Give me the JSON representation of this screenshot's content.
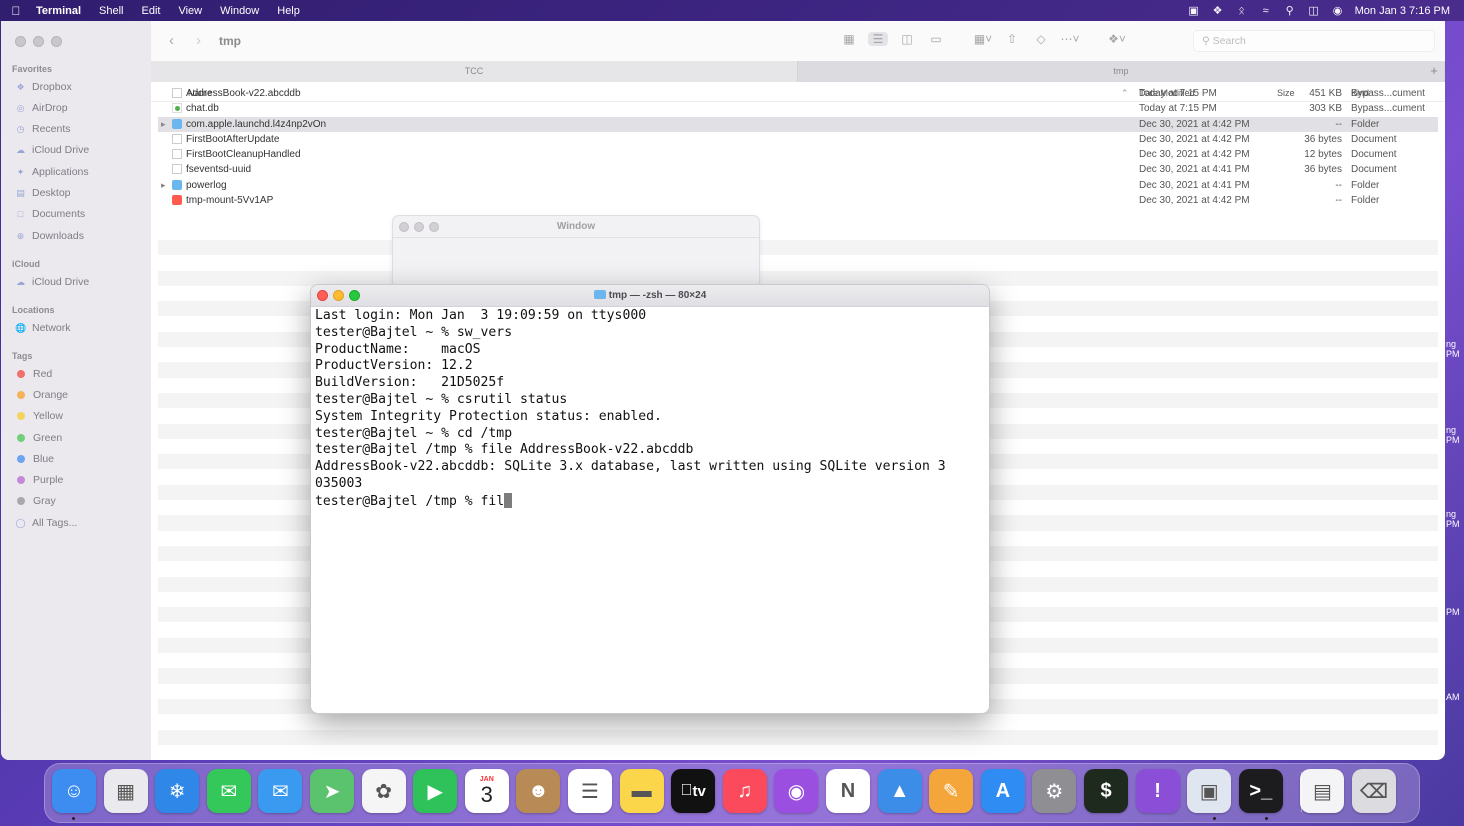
{
  "menubar": {
    "app": "Terminal",
    "items": [
      "Shell",
      "Edit",
      "View",
      "Window",
      "Help"
    ],
    "clock": "Mon Jan 3  7:16 PM",
    "status_icons": [
      "screen-mirror-icon",
      "dropbox-icon",
      "bluetooth-icon",
      "wifi-icon",
      "search-icon",
      "control-center-icon",
      "siri-icon"
    ]
  },
  "finder": {
    "title": "tmp",
    "search_placeholder": "Search",
    "tabs": [
      "TCC",
      "tmp"
    ],
    "sidebar": {
      "favorites_label": "Favorites",
      "favorites": [
        "Dropbox",
        "AirDrop",
        "Recents",
        "iCloud Drive",
        "Applications",
        "Desktop",
        "Documents",
        "Downloads"
      ],
      "icloud_label": "iCloud",
      "icloud": [
        "iCloud Drive"
      ],
      "locations_label": "Locations",
      "locations": [
        "Network"
      ],
      "tags_label": "Tags",
      "tags": [
        {
          "name": "Red",
          "color": "#f0706a"
        },
        {
          "name": "Orange",
          "color": "#f5b25a"
        },
        {
          "name": "Yellow",
          "color": "#f3d45c"
        },
        {
          "name": "Green",
          "color": "#6fcf7a"
        },
        {
          "name": "Blue",
          "color": "#6aa4f2"
        },
        {
          "name": "Purple",
          "color": "#c38ad9"
        },
        {
          "name": "Gray",
          "color": "#a8a8ad"
        }
      ],
      "all_tags": "All Tags..."
    },
    "columns": {
      "name": "Name",
      "date": "Date Modified",
      "size": "Size",
      "kind": "Kind"
    },
    "files": [
      {
        "name": "AddressBook-v22.abcddb",
        "date": "Today at 7:15 PM",
        "size": "451 KB",
        "kind": "Bypass...cument",
        "icon": "doc",
        "folder": false
      },
      {
        "name": "chat.db",
        "date": "Today at 7:15 PM",
        "size": "303 KB",
        "kind": "Bypass...cument",
        "icon": "db",
        "folder": false
      },
      {
        "name": "com.apple.launchd.l4z4np2vOn",
        "date": "Dec 30, 2021 at 4:42 PM",
        "size": "--",
        "kind": "Folder",
        "icon": "folder",
        "folder": true,
        "selected": true
      },
      {
        "name": "FirstBootAfterUpdate",
        "date": "Dec 30, 2021 at 4:42 PM",
        "size": "36 bytes",
        "kind": "Document",
        "icon": "doc",
        "folder": false
      },
      {
        "name": "FirstBootCleanupHandled",
        "date": "Dec 30, 2021 at 4:42 PM",
        "size": "12 bytes",
        "kind": "Document",
        "icon": "doc",
        "folder": false
      },
      {
        "name": "fseventsd-uuid",
        "date": "Dec 30, 2021 at 4:41 PM",
        "size": "36 bytes",
        "kind": "Document",
        "icon": "doc",
        "folder": false
      },
      {
        "name": "powerlog",
        "date": "Dec 30, 2021 at 4:41 PM",
        "size": "--",
        "kind": "Folder",
        "icon": "folder",
        "folder": true
      },
      {
        "name": "tmp-mount-5Vv1AP",
        "date": "Dec 30, 2021 at 4:42 PM",
        "size": "--",
        "kind": "Folder",
        "icon": "disk",
        "folder": false
      }
    ]
  },
  "bg_window": {
    "title": "Window"
  },
  "terminal": {
    "title": "tmp — -zsh — 80×24",
    "lines": [
      "Last login: Mon Jan  3 19:09:59 on ttys000",
      "tester@Bajtel ~ % sw_vers",
      "ProductName:    macOS",
      "ProductVersion: 12.2",
      "BuildVersion:   21D5025f",
      "tester@Bajtel ~ % csrutil status",
      "System Integrity Protection status: enabled.",
      "tester@Bajtel ~ % cd /tmp",
      "tester@Bajtel /tmp % file AddressBook-v22.abcddb",
      "AddressBook-v22.abcddb: SQLite 3.x database, last written using SQLite version 3",
      "035003"
    ],
    "prompt_line": "tester@Bajtel /tmp % fil"
  },
  "edge_text": [
    {
      "text": "ng\nPM"
    },
    {
      "text": "ng\nPM"
    },
    {
      "text": "ng\nPM"
    },
    {
      "text": "PM"
    },
    {
      "text": "AM"
    }
  ],
  "dock": {
    "calendar_month": "JAN",
    "calendar_day": "3",
    "tv_label": "tv",
    "apps": [
      {
        "name": "finder-icon",
        "color": "#3d8df0"
      },
      {
        "name": "launchpad-icon",
        "color": "#e9e9ee"
      },
      {
        "name": "safari-icon",
        "color": "#2f88e8"
      },
      {
        "name": "messages-icon",
        "color": "#34c759"
      },
      {
        "name": "mail-icon",
        "color": "#3a9af0"
      },
      {
        "name": "maps-icon",
        "color": "#5bc26e"
      },
      {
        "name": "photos-icon",
        "color": "#f5f5f5"
      },
      {
        "name": "facetime-icon",
        "color": "#2fc25a"
      },
      {
        "name": "calendar-icon",
        "color": "#ffffff"
      },
      {
        "name": "contacts-icon",
        "color": "#b88a55"
      },
      {
        "name": "reminders-icon",
        "color": "#ffffff"
      },
      {
        "name": "notes-icon",
        "color": "#fbd54a"
      },
      {
        "name": "apple-tv-icon",
        "color": "#111111"
      },
      {
        "name": "music-icon",
        "color": "#fa4a5c"
      },
      {
        "name": "podcasts-icon",
        "color": "#9b4fe0"
      },
      {
        "name": "news-icon",
        "color": "#ffffff"
      },
      {
        "name": "keynote-icon",
        "color": "#3b8de8"
      },
      {
        "name": "pages-icon",
        "color": "#f4a63a"
      },
      {
        "name": "app-store-icon",
        "color": "#2f8cf2"
      },
      {
        "name": "system-preferences-icon",
        "color": "#8e8e93"
      },
      {
        "name": "activity-monitor-icon",
        "color": "#1f2a1f"
      },
      {
        "name": "feedback-assistant-icon",
        "color": "#8a4fd6"
      },
      {
        "name": "preview-icon",
        "color": "#dfe6ef"
      },
      {
        "name": "terminal-icon",
        "color": "#1c1c1e"
      },
      {
        "name": "txt-document-icon",
        "color": "#f4f4f6"
      },
      {
        "name": "trash-icon",
        "color": "#dcdce0"
      }
    ]
  }
}
